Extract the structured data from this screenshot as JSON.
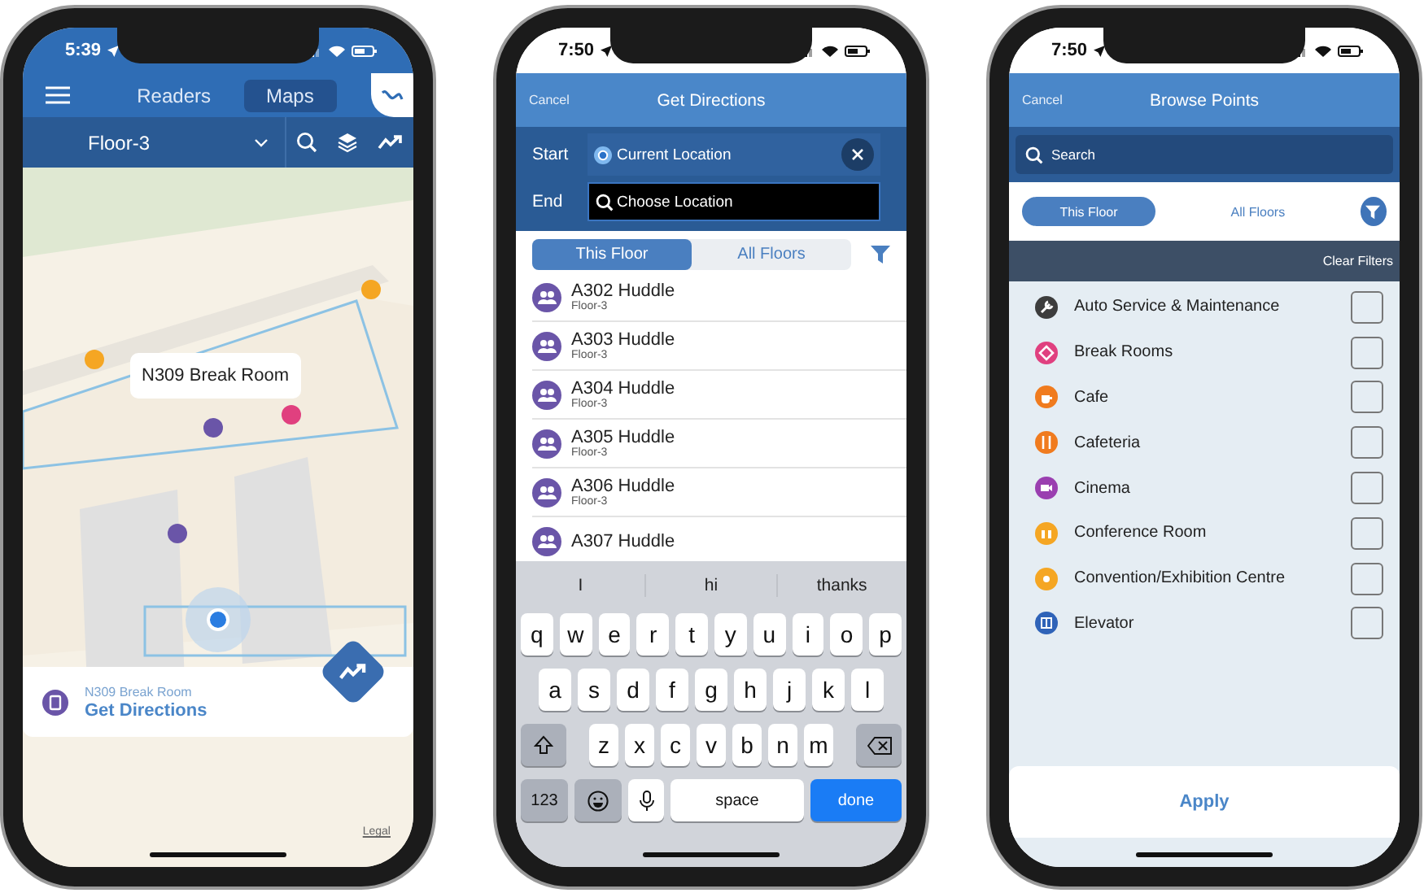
{
  "phones": [
    {
      "kind": "map",
      "time": "5:39",
      "tabs": [
        {
          "label": "Readers",
          "selected": false
        },
        {
          "label": "Maps",
          "selected": true
        }
      ],
      "floor": "Floor-3",
      "callout": "N309 Break Room",
      "card": {
        "subtitle": "N309 Break Room",
        "action": "Get Directions"
      },
      "legal": "Legal"
    },
    {
      "kind": "directions",
      "time": "7:50",
      "cancel": "Cancel",
      "title": "Get Directions",
      "start": {
        "label": "Start",
        "value": "Current Location"
      },
      "end": {
        "label": "End",
        "placeholder": "Choose Location"
      },
      "tabs": [
        {
          "label": "This Floor",
          "selected": true
        },
        {
          "label": "All Floors",
          "selected": false
        }
      ],
      "results": [
        {
          "name": "A302 Huddle",
          "floor": "Floor-3"
        },
        {
          "name": "A303 Huddle",
          "floor": "Floor-3"
        },
        {
          "name": "A304 Huddle",
          "floor": "Floor-3"
        },
        {
          "name": "A305 Huddle",
          "floor": "Floor-3"
        },
        {
          "name": "A306 Huddle",
          "floor": "Floor-3"
        },
        {
          "name": "A307 Huddle"
        }
      ],
      "keyboard": {
        "suggestions": [
          "I",
          "hi",
          "thanks"
        ],
        "rows": [
          [
            "q",
            "w",
            "e",
            "r",
            "t",
            "y",
            "u",
            "i",
            "o",
            "p"
          ],
          [
            "a",
            "s",
            "d",
            "f",
            "g",
            "h",
            "j",
            "k",
            "l"
          ],
          [
            "z",
            "x",
            "c",
            "v",
            "b",
            "n",
            "m"
          ]
        ],
        "numbers": "123",
        "space": "space",
        "done": "done"
      }
    },
    {
      "kind": "browse",
      "time": "7:50",
      "cancel": "Cancel",
      "title": "Browse Points",
      "search": {
        "placeholder": "Search"
      },
      "tabs": [
        {
          "label": "This Floor",
          "selected": true
        },
        {
          "label": "All Floors",
          "selected": false
        }
      ],
      "clear": "Clear Filters",
      "categories": [
        {
          "label": "Auto Service & Maintenance",
          "color": "#3d3d3d",
          "checked": false
        },
        {
          "label": "Break Rooms",
          "color": "#e0407f",
          "checked": false
        },
        {
          "label": "Cafe",
          "color": "#f07b1e",
          "checked": false
        },
        {
          "label": "Cafeteria",
          "color": "#f07b1e",
          "checked": false
        },
        {
          "label": "Cinema",
          "color": "#9a3fb0",
          "checked": false
        },
        {
          "label": "Conference Room",
          "color": "#f5a623",
          "checked": false
        },
        {
          "label": "Convention/Exhibition Centre",
          "color": "#f5a623",
          "checked": false
        },
        {
          "label": "Elevator",
          "color": "#2f63b8",
          "checked": false
        }
      ],
      "apply": "Apply"
    }
  ]
}
